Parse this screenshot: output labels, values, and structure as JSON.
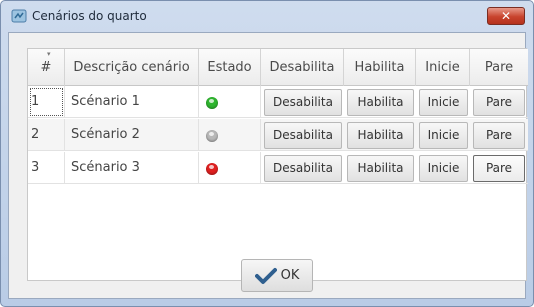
{
  "window": {
    "title": "Cenários do quarto",
    "close_label": "✕",
    "close_color": "#c8432d"
  },
  "table": {
    "headers": [
      "#",
      "Descrição cenário",
      "Estado",
      "Desabilita",
      "Habilita",
      "Inicie",
      "Pare"
    ],
    "rows": [
      {
        "num": "1",
        "description": "Scénario 1",
        "status_color": "#2fb52f",
        "disable": "Desabilita",
        "enable": "Habilita",
        "start": "Inicie",
        "stop": "Pare"
      },
      {
        "num": "2",
        "description": "Scénario 2",
        "status_color": "#b8b8b8",
        "disable": "Desabilita",
        "enable": "Habilita",
        "start": "Inicie",
        "stop": "Pare"
      },
      {
        "num": "3",
        "description": "Scénario 3",
        "status_color": "#e02020",
        "disable": "Desabilita",
        "enable": "Habilita",
        "start": "Inicie",
        "stop": "Pare"
      }
    ]
  },
  "footer": {
    "ok_label": "OK",
    "ok_icon": "checkmark-icon"
  }
}
